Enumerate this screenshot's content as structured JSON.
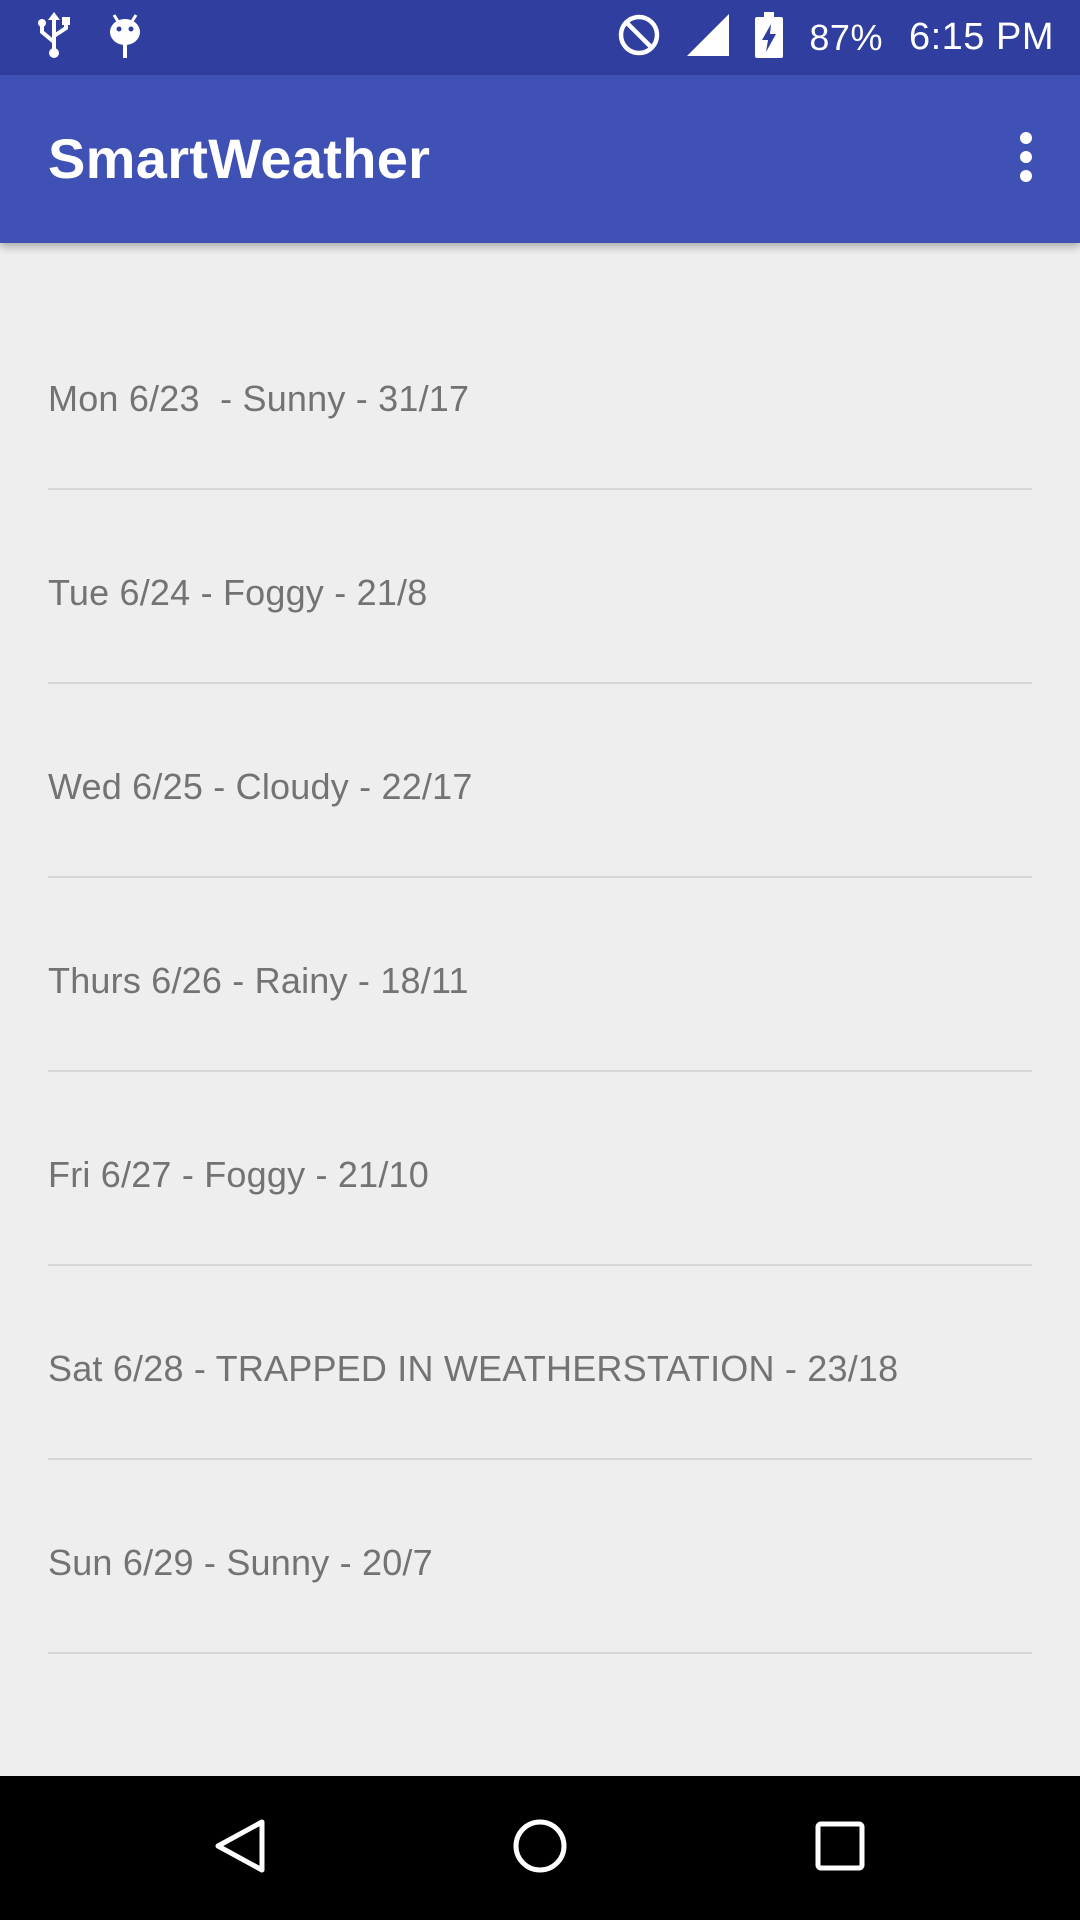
{
  "status_bar": {
    "battery_percent": "87%",
    "time": "6:15 PM",
    "icons": [
      "usb-icon",
      "android-debug-icon",
      "do-not-disturb-icon",
      "cell-signal-icon",
      "battery-charging-icon"
    ]
  },
  "app_bar": {
    "title": "SmartWeather",
    "menu_icon": "more-vert-icon",
    "background_color": "#3f51b5",
    "status_color": "#303f9f"
  },
  "forecast": [
    {
      "text": "Mon 6/23  - Sunny - 31/17"
    },
    {
      "text": "Tue 6/24 - Foggy - 21/8"
    },
    {
      "text": "Wed 6/25 - Cloudy - 22/17"
    },
    {
      "text": "Thurs 6/26 - Rainy - 18/11"
    },
    {
      "text": "Fri 6/27 - Foggy - 21/10"
    },
    {
      "text": "Sat 6/28 - TRAPPED IN WEATHERSTATION - 23/18"
    },
    {
      "text": "Sun 6/29 - Sunny - 20/7"
    }
  ],
  "nav_bar": {
    "icons": [
      "back-icon",
      "home-icon",
      "recents-icon"
    ]
  }
}
